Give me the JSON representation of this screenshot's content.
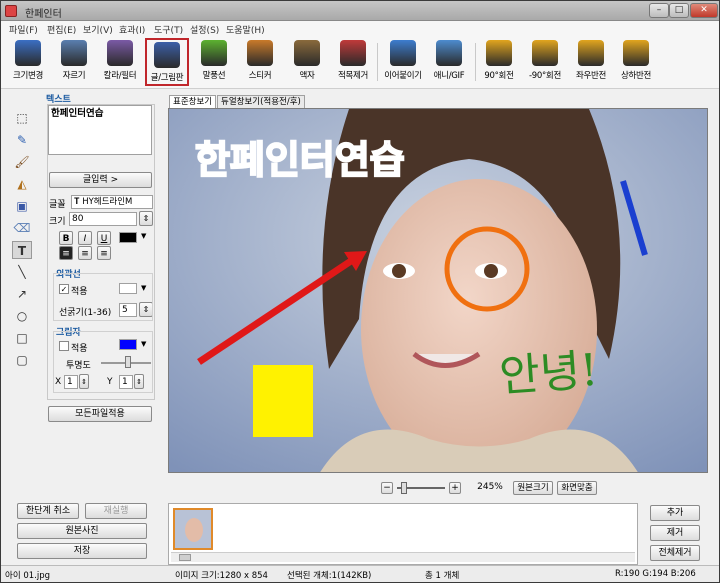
{
  "window": {
    "title": "한페인터"
  },
  "window_controls": {
    "minimize": "–",
    "maximize": "□",
    "close": "✕"
  },
  "menu": [
    "파일(F)",
    "편집(E)",
    "보기(V)",
    "효과(I)",
    "도구(T)",
    "설정(S)",
    "도움말(H)"
  ],
  "toolbar": [
    {
      "label": "크기변경",
      "icon": "resize-icon",
      "color": "#3b6fc4"
    },
    {
      "label": "자르기",
      "icon": "crop-icon",
      "color": "#5a7fb0"
    },
    {
      "label": "칼라/필터",
      "icon": "color-filter-icon",
      "color": "#7b5aa6"
    },
    {
      "label": "글/그림판",
      "icon": "text-draw-icon",
      "color": "#3c5fa8",
      "selected": true
    },
    {
      "label": "말풍선",
      "icon": "speech-bubble-icon",
      "color": "#5cb230"
    },
    {
      "label": "스티커",
      "icon": "sticker-icon",
      "color": "#c97a2a"
    },
    {
      "label": "액자",
      "icon": "frame-icon",
      "color": "#8a6a3c"
    },
    {
      "label": "적목제거",
      "icon": "red-eye-icon",
      "color": "#c03a3a"
    },
    {
      "label": "이어붙이기",
      "icon": "join-icon",
      "color": "#3d7dcf"
    },
    {
      "label": "애니/GIF",
      "icon": "gif-icon",
      "color": "#4d8ccf"
    },
    {
      "label": "90°회전",
      "icon": "rotate-right-icon",
      "color": "#e1a51e"
    },
    {
      "label": "-90°회전",
      "icon": "rotate-left-icon",
      "color": "#e1a51e"
    },
    {
      "label": "좌우반전",
      "icon": "flip-horizontal-icon",
      "color": "#e1a51e"
    },
    {
      "label": "상하반전",
      "icon": "flip-vertical-icon",
      "color": "#e1a51e"
    }
  ],
  "side_tools": [
    "select-icon",
    "pen-icon",
    "brush-icon",
    "fill-icon",
    "spray-icon",
    "eraser-icon",
    "text-icon",
    "line-icon",
    "arrow-icon",
    "circle-icon",
    "rectangle-icon",
    "rounded-rect-icon"
  ],
  "text_panel": {
    "section_label": "텍스트",
    "text_value": "한페인터연습",
    "input_button": "글입력 >",
    "font_label": "글꼴",
    "font_value": "HY헤드라인M",
    "size_label": "크기",
    "size_value": "80",
    "bold": "B",
    "italic": "I",
    "underline": "U",
    "strike": "S",
    "text_color": "#000000",
    "outline_label": "외곽선",
    "outline_apply": "적용",
    "outline_checked": true,
    "outline_color": "#ffffff",
    "outline_width_label": "선굵기(1-36)",
    "outline_width_value": "5",
    "shadow_label": "그림자",
    "shadow_apply": "적용",
    "shadow_checked": false,
    "shadow_color": "#0000ff",
    "transparency_label": "투명도",
    "x_label": "X",
    "x_value": "1",
    "y_label": "Y",
    "y_value": "1",
    "apply_all_button": "모든파일적용"
  },
  "tabs": [
    "표준창보기",
    "듀얼창보기(적용전/후)"
  ],
  "canvas": {
    "overlay_text": "한페인터연습",
    "overlay_text_color": "#6a1a86",
    "handwriting": "안녕!",
    "arrow_color": "#e01818",
    "circle_color": "#f07010",
    "line_color": "#1a3fd0",
    "rect_color": "#fff200",
    "handwriting_color": "#2d8c24"
  },
  "zoom": {
    "minus": "−",
    "plus": "+",
    "value": "245%",
    "original_button": "원본크기",
    "fit_button": "화면맞춤"
  },
  "bottom_left": {
    "undo": "한단계 취소",
    "redo": "재실행",
    "original": "원본사진",
    "save": "저장"
  },
  "filmstrip_right": {
    "add": "추가",
    "remove": "제거",
    "remove_all": "전체제거"
  },
  "status": {
    "file": "아이 01.jpg",
    "size": "이미지 크기:1280 x 854",
    "selected": "선택된 개체:1(142KB)",
    "total": "총 1 개체",
    "rgb": "R:190 G:194 B:206"
  }
}
